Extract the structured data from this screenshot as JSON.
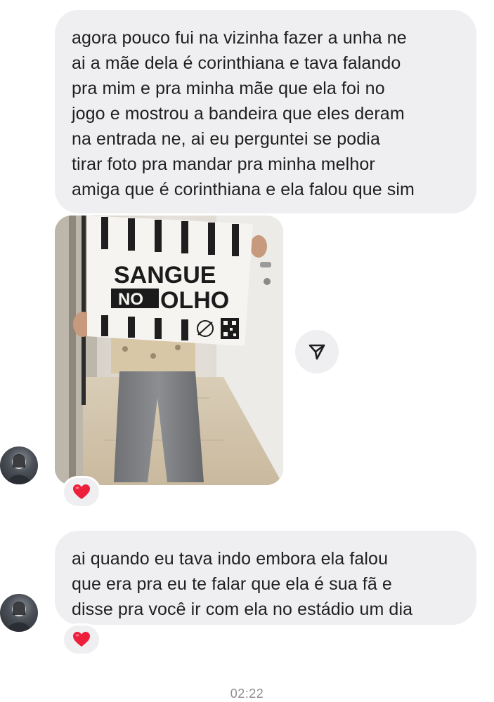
{
  "messages": [
    {
      "lines": [
        "agora pouco fui na vizinha fazer a unha ne",
        "ai a mãe dela é corinthiana e tava falando",
        "pra mim e pra minha mãe que ela foi no",
        "jogo e mostrou a bandeira que eles deram",
        "na entrada ne, ai eu perguntei se podia",
        "tirar foto pra mandar pra minha melhor",
        "amiga que é corinthiana e ela falou que sim"
      ]
    },
    {
      "flag_text_line1": "SANGUE",
      "flag_text_no": "NO",
      "flag_text_olho": "OLHO",
      "reaction": "❤️"
    },
    {
      "lines": [
        "ai quando eu tava indo embora ela falou",
        "que era pra eu te falar que ela é sua fã e",
        "disse pra você ir com ela no estádio um dia"
      ],
      "reaction": "❤️"
    }
  ],
  "timestamp": "02:22",
  "icons": {
    "share": "send-icon",
    "avatar": "avatar",
    "reaction": "heart-icon"
  }
}
